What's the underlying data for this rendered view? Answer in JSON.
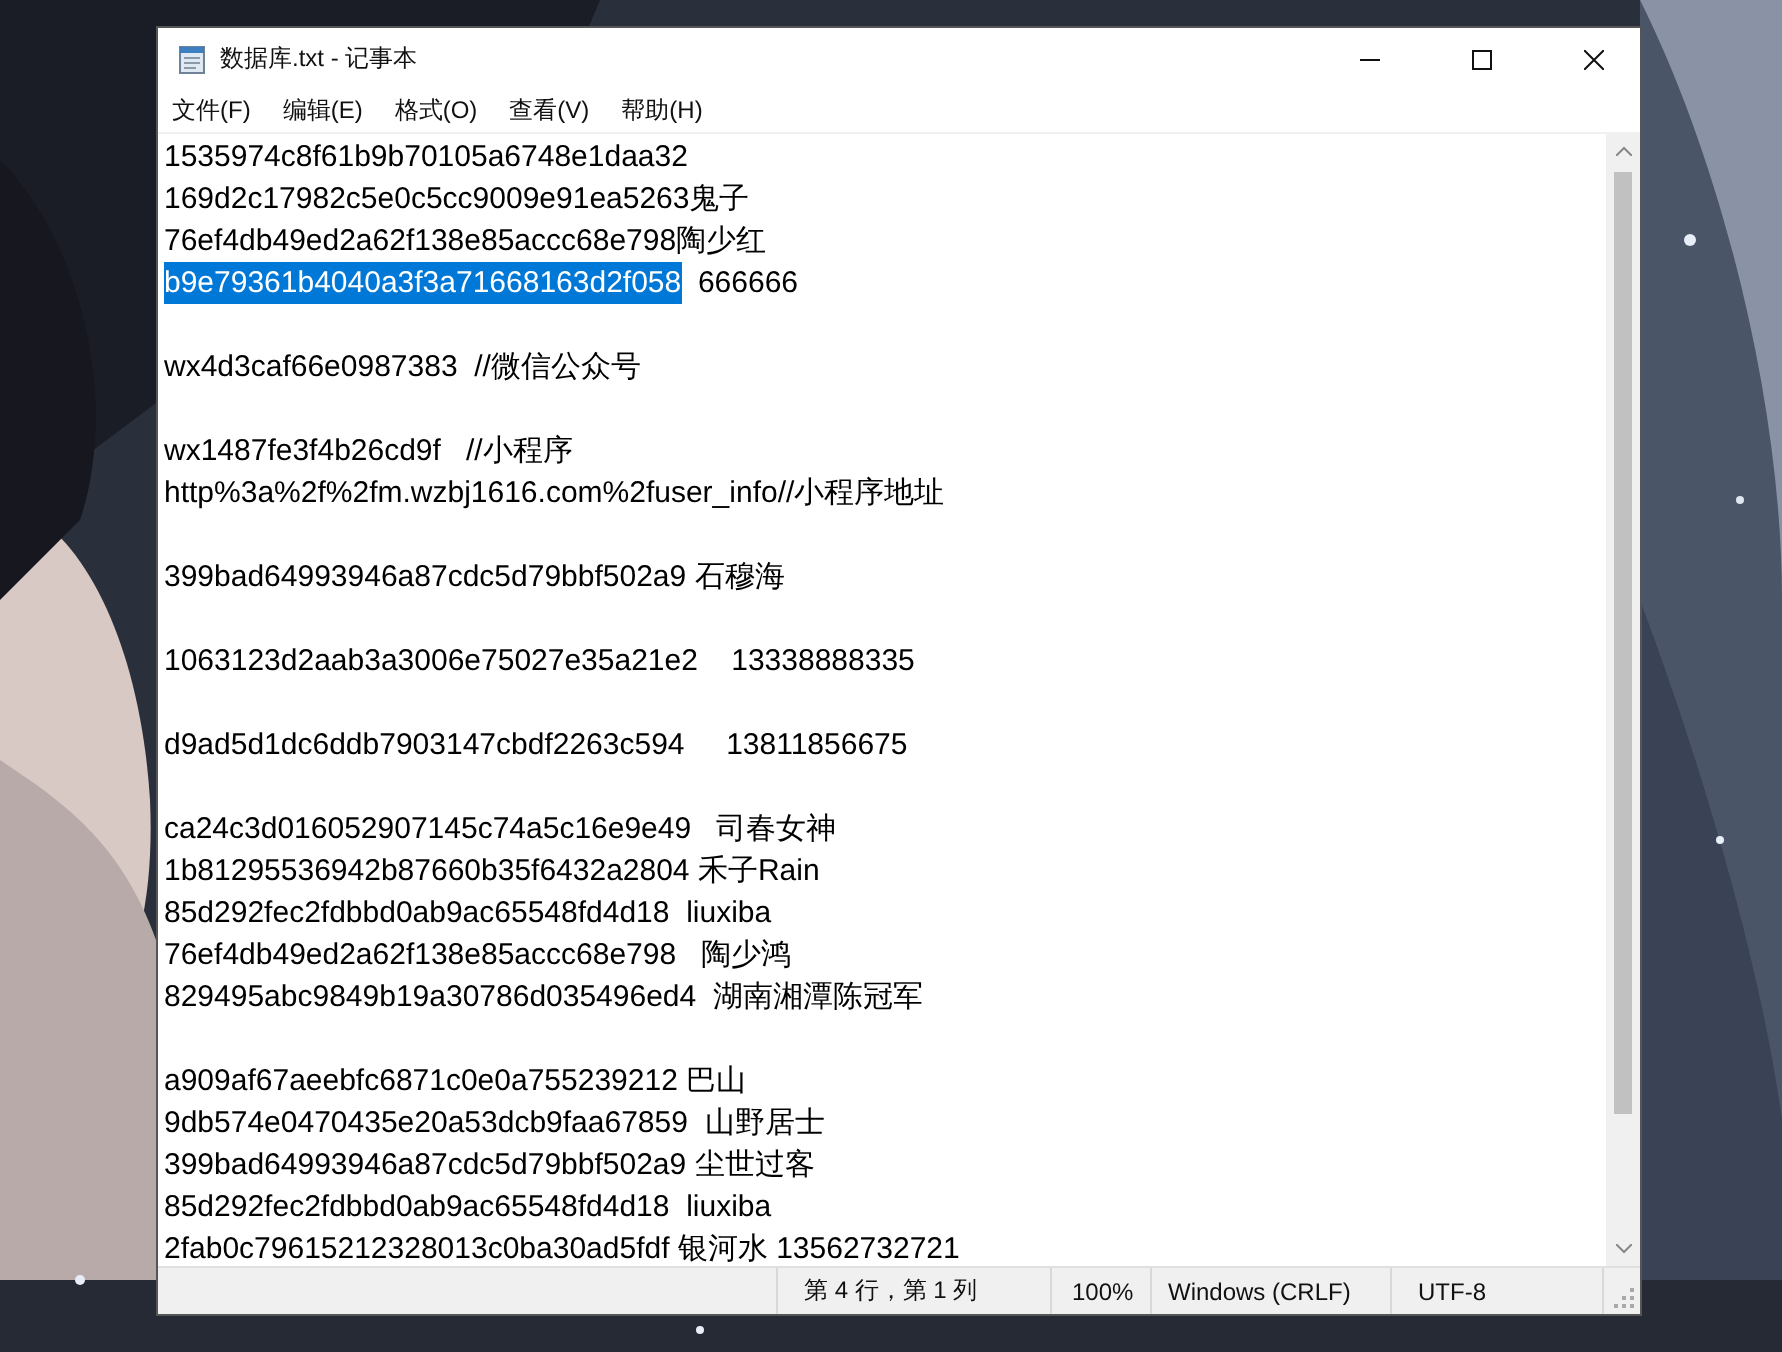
{
  "window": {
    "title": "数据库.txt - 记事本"
  },
  "menu": [
    "文件(F)",
    "编辑(E)",
    "格式(O)",
    "查看(V)",
    "帮助(H)"
  ],
  "blocks": [
    [
      {
        "text": "1535974c8f61b9b70105a6748e1daa32"
      },
      {
        "text": "169d2c17982c5e0c5cc9009e91ea5263鬼子"
      },
      {
        "text": "76ef4db49ed2a62f138e85accc68e798陶少红"
      },
      {
        "selected_text": "b9e79361b4040a3f3a71668163d2f058",
        "text": "  666666"
      }
    ],
    [
      {
        "text": "wx4d3caf66e0987383  //微信公众号"
      }
    ],
    [
      {
        "text": "wx1487fe3f4b26cd9f   //小程序"
      },
      {
        "text": "http%3a%2f%2fm.wzbj1616.com%2fuser_info//小程序地址"
      }
    ],
    [
      {
        "text": "399bad64993946a87cdc5d79bbf502a9 石穆海"
      }
    ],
    [
      {
        "text": "1063123d2aab3a3006e75027e35a21e2    13338888335"
      }
    ],
    [
      {
        "text": "d9ad5d1dc6ddb7903147cbdf2263c594     13811856675"
      }
    ],
    [
      {
        "text": "ca24c3d016052907145c74a5c16e9e49   司春女神"
      },
      {
        "text": "1b81295536942b87660b35f6432a2804 禾子Rain"
      },
      {
        "text": "85d292fec2fdbbd0ab9ac65548fd4d18  liuxiba"
      },
      {
        "text": "76ef4db49ed2a62f138e85accc68e798   陶少鸿"
      },
      {
        "text": "829495abc9849b19a30786d035496ed4  湖南湘潭陈冠军"
      }
    ],
    [
      {
        "text": "a909af67aeebfc6871c0e0a755239212 巴山"
      },
      {
        "text": "9db574e0470435e20a53dcb9faa67859  山野居士"
      },
      {
        "text": "399bad64993946a87cdc5d79bbf502a9 尘世过客"
      },
      {
        "text": "85d292fec2fdbbd0ab9ac65548fd4d18  liuxiba"
      },
      {
        "text": "2fab0c79615212328013c0ba30ad5fdf 银河水 13562732721"
      }
    ]
  ],
  "status_bar": [
    "第 4 行，第 1 列",
    "100%",
    "Windows (CRLF)",
    "UTF-8"
  ]
}
